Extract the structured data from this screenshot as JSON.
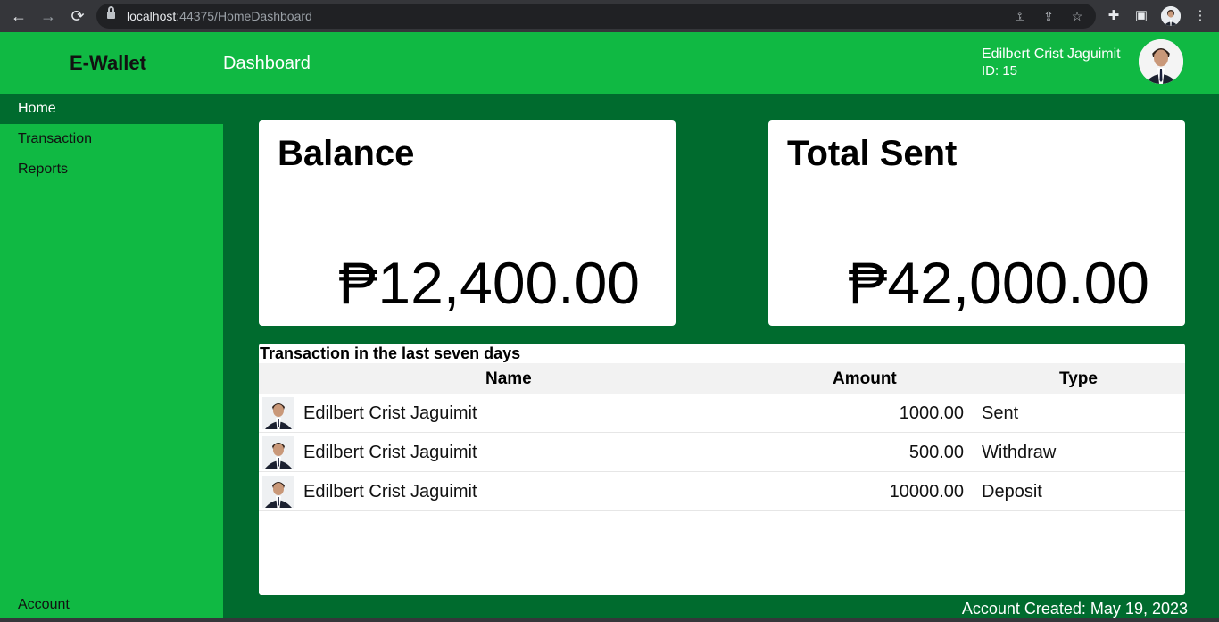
{
  "browser": {
    "url_host": "localhost",
    "url_path": ":44375/HomeDashboard",
    "icons": [
      "back-icon",
      "forward-icon",
      "reload-icon",
      "lock-icon",
      "key-icon",
      "share-icon",
      "star-icon",
      "extensions-icon",
      "sidepanel-icon",
      "menu-icon"
    ]
  },
  "header": {
    "brand": "E-Wallet",
    "title": "Dashboard",
    "user_name": "Edilbert Crist Jaguimit",
    "user_id": "ID: 15"
  },
  "sidebar": {
    "items": [
      {
        "label": "Home",
        "active": true
      },
      {
        "label": "Transaction",
        "active": false
      },
      {
        "label": "Reports",
        "active": false
      }
    ],
    "account": "Account"
  },
  "cards": {
    "balance": {
      "title": "Balance",
      "value": "₱12,400.00"
    },
    "sent": {
      "title": "Total Sent",
      "value": "₱42,000.00"
    }
  },
  "transactions": {
    "title": "Transaction in the last seven days",
    "columns": {
      "name": "Name",
      "amount": "Amount",
      "type": "Type"
    },
    "rows": [
      {
        "name": "Edilbert Crist Jaguimit",
        "amount": "1000.00",
        "type": "Sent"
      },
      {
        "name": "Edilbert Crist Jaguimit",
        "amount": "500.00",
        "type": "Withdraw"
      },
      {
        "name": "Edilbert Crist Jaguimit",
        "amount": "10000.00",
        "type": "Deposit"
      }
    ]
  },
  "footer": {
    "created": "Account Created: May 19, 2023"
  },
  "colors": {
    "header_green": "#10b943",
    "dark_green": "#006b2e"
  }
}
